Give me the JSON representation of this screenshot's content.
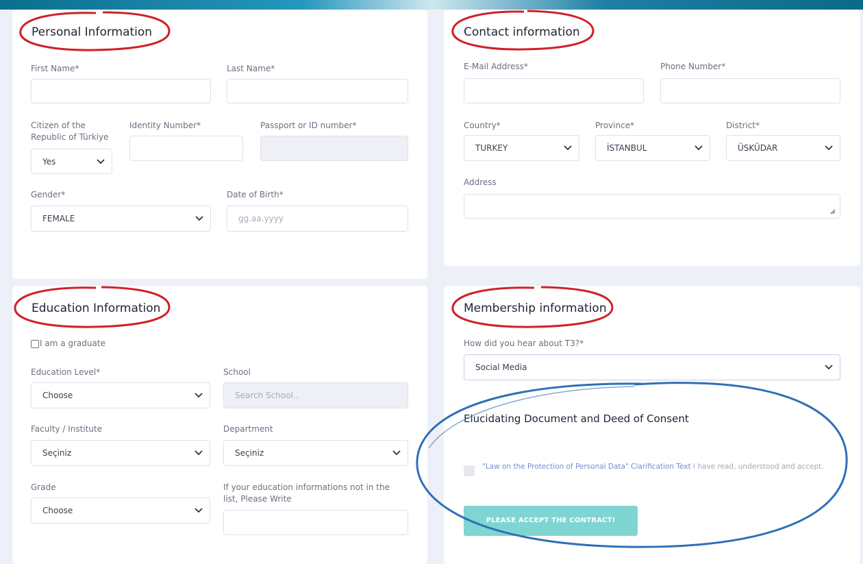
{
  "personal": {
    "title": "Personal Information",
    "first_name_label": "First Name*",
    "last_name_label": "Last Name*",
    "citizen_label": "Citizen of the Republic of Türkiye",
    "citizen_value": "Yes",
    "identity_label": "Identity Number*",
    "passport_label": "Passport or ID number*",
    "gender_label": "Gender*",
    "gender_value": "FEMALE",
    "dob_label": "Date of Birth*",
    "dob_placeholder": "gg.aa.yyyy"
  },
  "contact": {
    "title": "Contact information",
    "email_label": "E-Mail Address*",
    "phone_label": "Phone Number*",
    "country_label": "Country*",
    "country_value": "TURKEY",
    "province_label": "Province*",
    "province_value": "İSTANBUL",
    "district_label": "District*",
    "district_value": "ÜSKÜDAR",
    "address_label": "Address"
  },
  "education": {
    "title": "Education Information",
    "graduate_label": "I am a graduate",
    "level_label": "Education Level*",
    "level_value": "Choose",
    "school_label": "School",
    "school_placeholder": "Search School..",
    "faculty_label": "Faculty / Institute",
    "faculty_value": "Seçiniz",
    "department_label": "Department",
    "department_value": "Seçiniz",
    "grade_label": "Grade",
    "grade_value": "Choose",
    "other_label": "If your education informations not in the list, Please Write"
  },
  "membership": {
    "title": "Membership information",
    "hear_label": "How did you hear about T3?*",
    "hear_value": "Social Media",
    "consent_title": "Elucidating Document and Deed of Consent",
    "consent_link": "\"Law on the Protection of Personal Data\" Clarification Text",
    "consent_text": " I have read, understood and accept.",
    "accept_button": "PLEASE ACCEPT THE CONTRACT!"
  },
  "colors": {
    "annotation_red": "#d0202a",
    "annotation_blue": "#2f6fb5",
    "accept_button": "#7fd5d2"
  }
}
